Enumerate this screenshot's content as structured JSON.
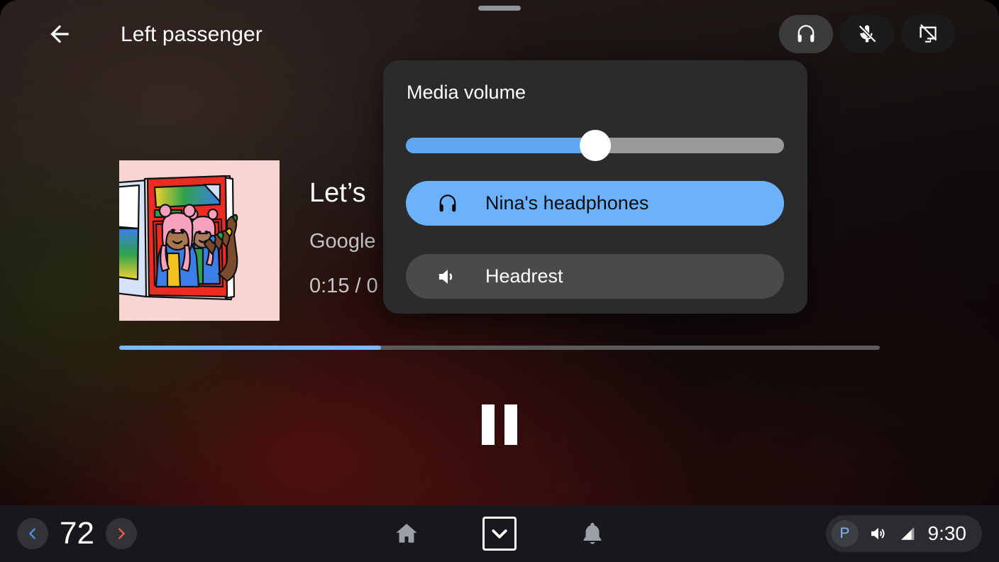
{
  "app_bar": {
    "back_icon": "arrow-back-icon",
    "title": "Left passenger",
    "actions": [
      {
        "icon": "headphones-icon",
        "name": "headphones-button",
        "active": true
      },
      {
        "icon": "mic-off-icon",
        "name": "mic-off-button",
        "active": false
      },
      {
        "icon": "screen-off-icon",
        "name": "screen-off-button",
        "active": false
      }
    ]
  },
  "drag_handle": {
    "name": "drag-handle"
  },
  "now_playing": {
    "album_art": "album-art-two-women-magazine",
    "title": "Let’s",
    "artist": "Google",
    "time": "0:15 / 0",
    "progress_percent": 34.4,
    "progress_fill_color": "#7ab8fa",
    "progress_track_color": "#5b5b5b",
    "transport": {
      "state": "playing",
      "button_icon": "pause-icon"
    }
  },
  "volume_popup": {
    "title": "Media volume",
    "slider": {
      "value_percent": 50,
      "fill_color": "#5fa6f5",
      "track_color": "#9a9a9a",
      "thumb_color": "#ffffff"
    },
    "devices": [
      {
        "label": "Nina's headphones",
        "icon": "headphones-icon",
        "selected": true,
        "color": "#6cb2fb"
      },
      {
        "label": "Headrest",
        "icon": "speaker-icon",
        "selected": false,
        "color": "#4a4a4a"
      }
    ]
  },
  "system_bar": {
    "temperature": {
      "decrease_icon": "chevron-left-icon",
      "decrease_color": "#4a90e2",
      "value": "72",
      "increase_icon": "chevron-right-icon",
      "increase_color": "#e8604c"
    },
    "nav": [
      {
        "name": "home-button",
        "icon": "home-icon"
      },
      {
        "name": "expand-button",
        "icon": "chevron-down-icon"
      },
      {
        "name": "notifications-button",
        "icon": "bell-icon"
      }
    ],
    "status": {
      "park_label": "P",
      "park_color": "#8ab4f8",
      "volume_icon": "volume-icon",
      "signal_icon": "signal-icon",
      "clock": "9:30"
    }
  }
}
